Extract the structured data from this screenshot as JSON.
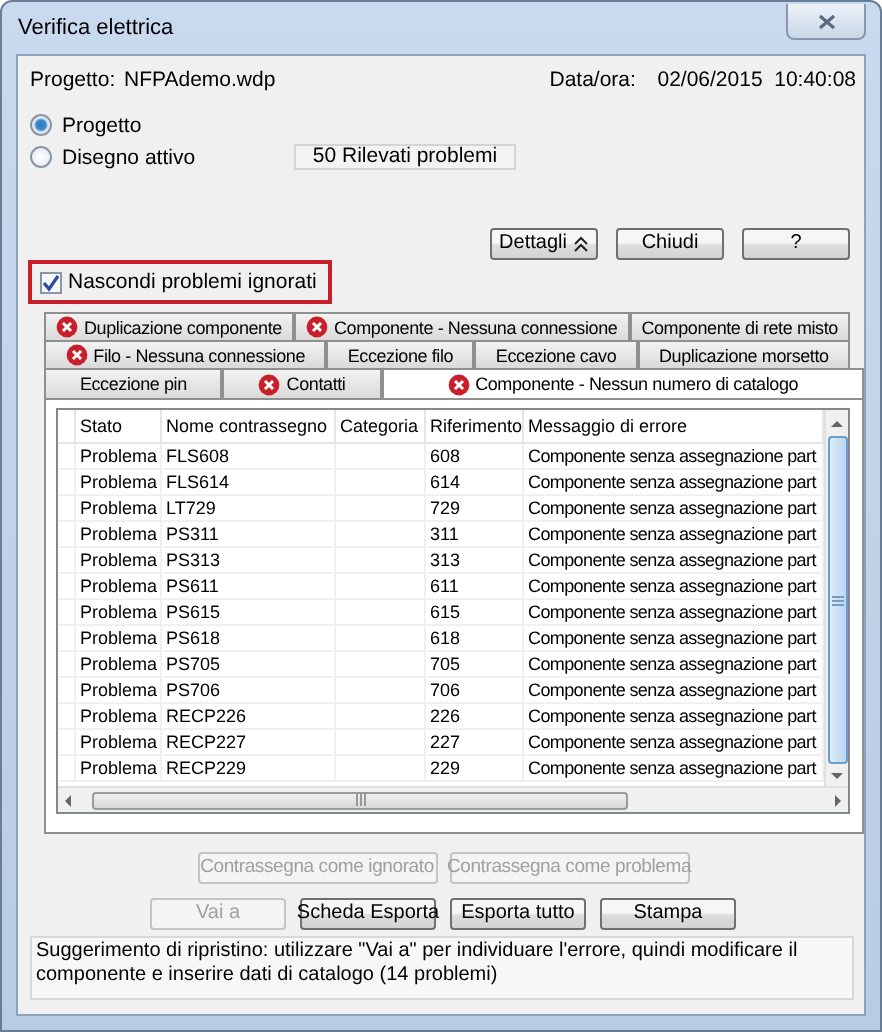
{
  "window": {
    "title": "Verifica elettrica"
  },
  "header": {
    "project_label": "Progetto:",
    "project": "NFPAdemo.wdp",
    "date_label": "Data/ora:",
    "date": "02/06/2015  10:40:08"
  },
  "scope": [
    {
      "label": "Progetto",
      "selected": true
    },
    {
      "label": "Disegno attivo",
      "selected": false
    }
  ],
  "summary": "50 Rilevati problemi",
  "top_buttons": [
    {
      "label": "Dettagli",
      "kind": "expander"
    },
    {
      "label": "Chiudi",
      "kind": "plain"
    },
    {
      "label": "?",
      "kind": "plain"
    }
  ],
  "hide_ignored": {
    "label": "Nascondi problemi ignorati",
    "checked": true
  },
  "tab_rows": [
    [
      {
        "label": "Duplicazione componente",
        "error": true,
        "selected": false
      },
      {
        "label": "Componente - Nessuna connessione",
        "error": true,
        "selected": false
      },
      {
        "label": "Componente di rete misto",
        "error": false,
        "selected": false
      }
    ],
    [
      {
        "label": "Filo - Nessuna connessione",
        "error": true,
        "selected": false
      },
      {
        "label": "Eccezione filo",
        "error": false,
        "selected": false
      },
      {
        "label": "Eccezione cavo",
        "error": false,
        "selected": false
      },
      {
        "label": "Duplicazione morsetto",
        "error": false,
        "selected": false
      }
    ],
    [
      {
        "label": "Eccezione pin",
        "error": false,
        "selected": false
      },
      {
        "label": "Contatti",
        "error": true,
        "selected": false
      },
      {
        "label": "Componente - Nessun numero di catalogo",
        "error": true,
        "selected": true
      }
    ]
  ],
  "table": {
    "columns": [
      "Stato",
      "Nome contrassegno",
      "Categoria",
      "Riferimento",
      "Messaggio di errore"
    ],
    "rows": [
      [
        "Problema",
        "FLS608",
        "",
        "608",
        "Componente senza assegnazione part"
      ],
      [
        "Problema",
        "FLS614",
        "",
        "614",
        "Componente senza assegnazione part"
      ],
      [
        "Problema",
        "LT729",
        "",
        "729",
        "Componente senza assegnazione part"
      ],
      [
        "Problema",
        "PS311",
        "",
        "311",
        "Componente senza assegnazione part"
      ],
      [
        "Problema",
        "PS313",
        "",
        "313",
        "Componente senza assegnazione part"
      ],
      [
        "Problema",
        "PS611",
        "",
        "611",
        "Componente senza assegnazione part"
      ],
      [
        "Problema",
        "PS615",
        "",
        "615",
        "Componente senza assegnazione part"
      ],
      [
        "Problema",
        "PS618",
        "",
        "618",
        "Componente senza assegnazione part"
      ],
      [
        "Problema",
        "PS705",
        "",
        "705",
        "Componente senza assegnazione part"
      ],
      [
        "Problema",
        "PS706",
        "",
        "706",
        "Componente senza assegnazione part"
      ],
      [
        "Problema",
        "RECP226",
        "",
        "226",
        "Componente senza assegnazione part"
      ],
      [
        "Problema",
        "RECP227",
        "",
        "227",
        "Componente senza assegnazione part"
      ],
      [
        "Problema",
        "RECP229",
        "",
        "229",
        "Componente senza assegnazione part"
      ]
    ]
  },
  "mark_buttons": [
    {
      "label": "Contrassegna come ignorato",
      "disabled": true
    },
    {
      "label": "Contrassegna come problema",
      "disabled": true
    }
  ],
  "action_buttons": [
    {
      "label": "Vai a",
      "disabled": true
    },
    {
      "label": "Scheda Esporta",
      "disabled": false
    },
    {
      "label": "Esporta tutto",
      "disabled": false
    },
    {
      "label": "Stampa",
      "disabled": false
    }
  ],
  "hint": "Suggerimento di ripristino: utilizzare \"Vai a\" per individuare l'errore, quindi modificare il componente e inserire dati di catalogo (14 problemi)"
}
